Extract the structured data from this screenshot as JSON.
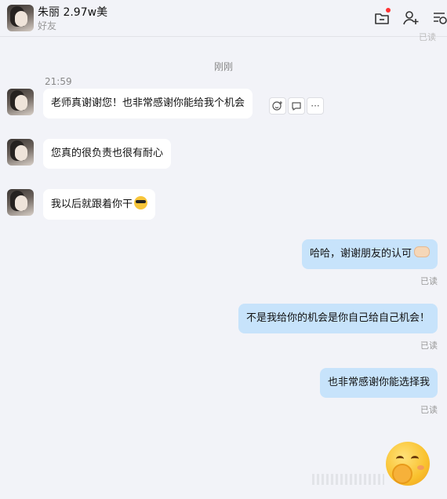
{
  "header": {
    "contact_name": "朱丽 2.97w美",
    "relationship": "好友",
    "icons": [
      "folder-icon",
      "add-friend-icon",
      "chat-list-icon"
    ],
    "peek_status": "已读"
  },
  "chat": {
    "time_divider": "刚刚",
    "first_time": "21:59",
    "incoming": [
      {
        "text": "老师真谢谢您！也非常感谢你能给我个机会"
      },
      {
        "text": "您真的很负责也很有耐心"
      },
      {
        "text": "我以后就跟着你干"
      }
    ],
    "outgoing": [
      {
        "text": "哈哈，谢谢朋友的认可",
        "status": "已读"
      },
      {
        "text": "不是我给你的机会是你自己给自己机会！",
        "status": "已读"
      },
      {
        "text": "也非常感谢你能选择我",
        "status": "已读"
      }
    ],
    "actions": {
      "more": "···"
    }
  },
  "colors": {
    "background": "#f2f3f8",
    "incoming_bubble": "#ffffff",
    "outgoing_bubble": "#c7e3fb",
    "notification_dot": "#ff3333"
  }
}
